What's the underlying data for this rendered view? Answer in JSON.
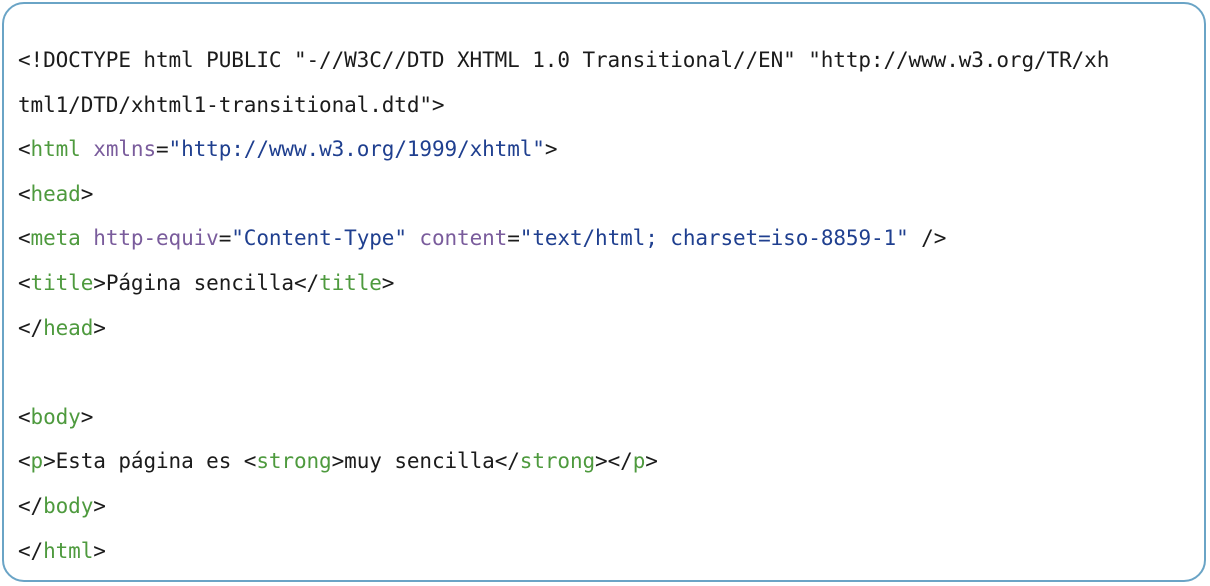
{
  "code_block": {
    "doctype_line1": "<!DOCTYPE html PUBLIC \"-//W3C//DTD XHTML 1.0 Transitional//EN\" \"http://www.w3.org/TR/xh",
    "doctype_line2": "tml1/DTD/xhtml1-transitional.dtd\">",
    "html_open": {
      "lt": "<",
      "tag": "html",
      "space": " ",
      "attr": "xmlns",
      "eq": "=",
      "value": "\"http://www.w3.org/1999/xhtml\"",
      "gt": ">"
    },
    "head_open": {
      "lt": "<",
      "tag": "head",
      "gt": ">"
    },
    "meta": {
      "lt": "<",
      "tag": "meta",
      "sp1": " ",
      "attr1": "http-equiv",
      "eq1": "=",
      "value1": "\"Content-Type\"",
      "sp2": " ",
      "attr2": "content",
      "eq2": "=",
      "value2": "\"text/html; charset=iso-8859-1\"",
      "end": " />"
    },
    "title": {
      "lt": "<",
      "tag": "title",
      "gt": ">",
      "text": "Página sencilla",
      "close_lt": "</",
      "close_tag": "title",
      "close_gt": ">"
    },
    "head_close": {
      "lt": "</",
      "tag": "head",
      "gt": ">"
    },
    "body_open": {
      "lt": "<",
      "tag": "body",
      "gt": ">"
    },
    "paragraph": {
      "lt": "<",
      "tag": "p",
      "gt": ">",
      "text1": "Esta página es ",
      "strong_lt": "<",
      "strong_tag": "strong",
      "strong_gt": ">",
      "strong_text": "muy sencilla",
      "strong_close_lt": "</",
      "strong_close_tag": "strong",
      "strong_close_gt": "></",
      "p_close_tag": "p",
      "p_close_gt": ">"
    },
    "body_close": {
      "lt": "</",
      "tag": "body",
      "gt": ">"
    },
    "html_close": {
      "lt": "</",
      "tag": "html",
      "gt": ">"
    },
    "colors": {
      "tag": "#4e9a3e",
      "attribute": "#7a5c9c",
      "value": "#1f3f8f",
      "text": "#1b1b1b",
      "border": "#6aa4c6"
    }
  }
}
